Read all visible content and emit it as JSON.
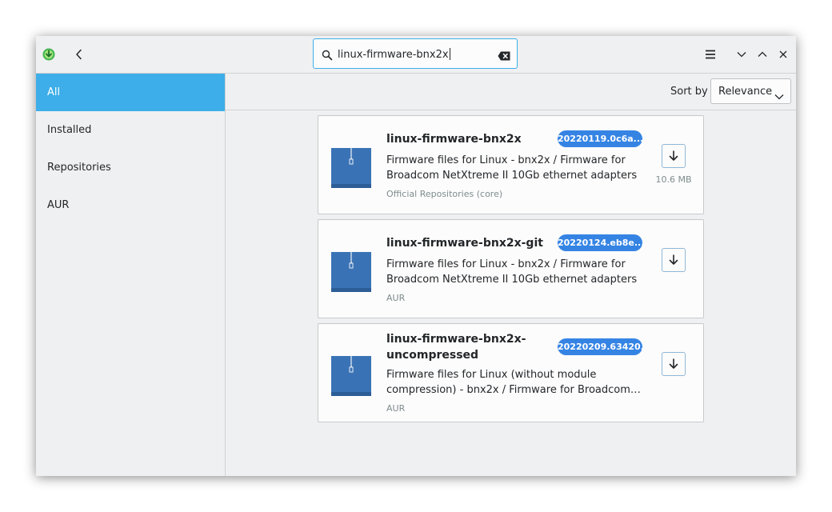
{
  "search": {
    "value": "linux-firmware-bnx2x"
  },
  "sidebar": {
    "items": [
      {
        "label": "All",
        "active": true
      },
      {
        "label": "Installed",
        "active": false
      },
      {
        "label": "Repositories",
        "active": false
      },
      {
        "label": "AUR",
        "active": false
      }
    ]
  },
  "sort": {
    "label": "Sort by",
    "selected": "Relevance"
  },
  "packages": [
    {
      "name": "linux-firmware-bnx2x",
      "version": "20220119.0c6a...",
      "description_lines": [
        "Firmware files for Linux - bnx2x / Firmware for",
        "Broadcom NetXtreme II 10Gb ethernet adapters"
      ],
      "repository": "Official Repositories (core)",
      "size": "10.6 MB"
    },
    {
      "name": "linux-firmware-bnx2x-git",
      "version": "20220124.eb8e...",
      "description_lines": [
        "Firmware files for Linux - bnx2x / Firmware for",
        "Broadcom NetXtreme II 10Gb ethernet adapters"
      ],
      "repository": "AUR"
    },
    {
      "name_lines": [
        "linux-firmware-bnx2x-",
        "uncompressed"
      ],
      "version": "20220209.63420...",
      "description_lines": [
        "Firmware files for Linux (without module",
        "compression) - bnx2x / Firmware for Broadcom Ne..."
      ],
      "repository": "AUR"
    }
  ],
  "icons": {
    "app": "download-app-icon",
    "back": "chevron-left-icon",
    "search": "search-icon",
    "clear": "clear-text-icon",
    "menu": "hamburger-menu-icon",
    "minimize": "chevron-down-icon",
    "maximize": "chevron-up-icon",
    "close": "close-icon",
    "package": "archive-package-icon",
    "download": "download-arrow-icon"
  },
  "colors": {
    "accent": "#3daee9",
    "version_badge": "#3584e4",
    "window_bg": "#eff0f1",
    "card_bg": "#fcfcfc"
  }
}
